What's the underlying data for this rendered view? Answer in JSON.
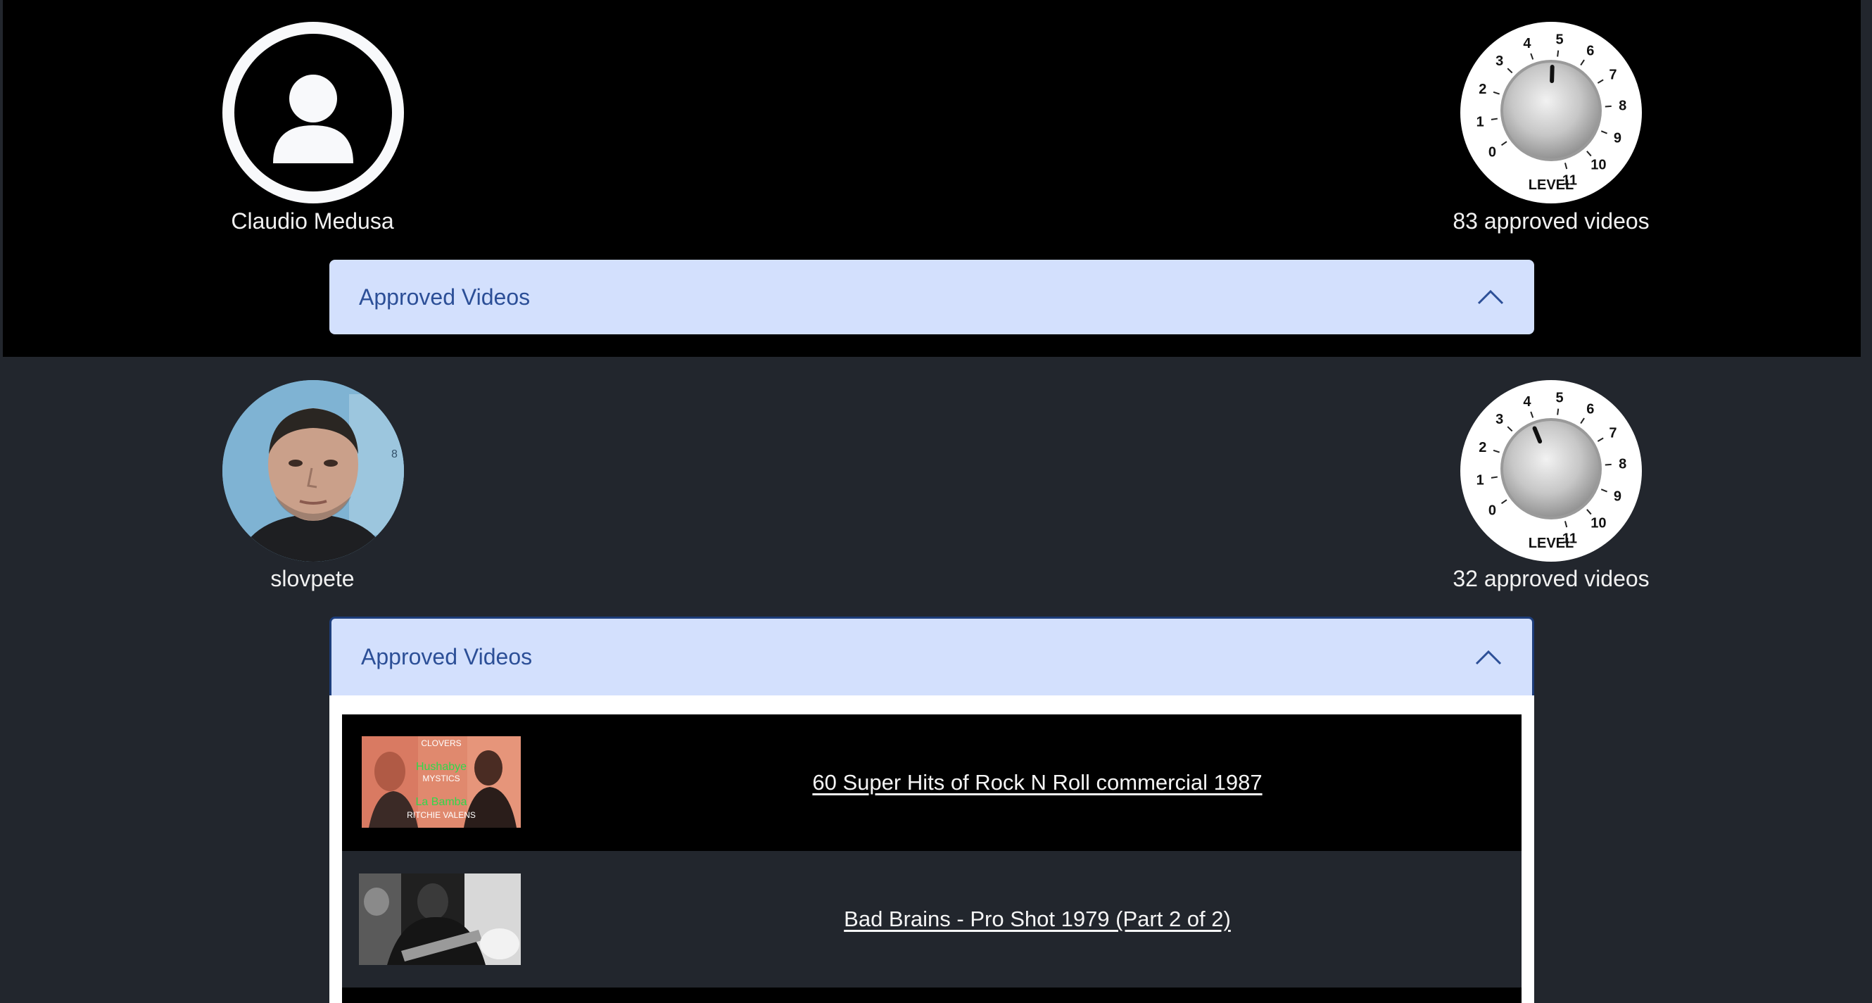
{
  "users": [
    {
      "name": "Claudio Medusa",
      "avatar_icon": "user-silhouette-icon",
      "approved_count_text": "83 approved videos",
      "knob": {
        "label": "LEVEL",
        "ticks": [
          "0",
          "1",
          "2",
          "3",
          "4",
          "5",
          "6",
          "7",
          "8",
          "9",
          "10",
          "11"
        ],
        "level": 4.8
      },
      "accordion": {
        "label": "Approved Videos",
        "expanded": false,
        "chevron_icon": "chevron-up-icon"
      }
    },
    {
      "name": "slovpete",
      "avatar_icon": "user-photo",
      "approved_count_text": "32 approved videos",
      "knob": {
        "label": "LEVEL",
        "ticks": [
          "0",
          "1",
          "2",
          "3",
          "4",
          "5",
          "6",
          "7",
          "8",
          "9",
          "10",
          "11"
        ],
        "level": 3.9
      },
      "accordion": {
        "label": "Approved Videos",
        "expanded": true,
        "chevron_icon": "chevron-up-icon"
      },
      "videos": [
        {
          "title": "60 Super Hits of Rock N Roll commercial 1987",
          "thumb_text": [
            "CLOVERS",
            "Hushabye",
            "MYSTICS",
            "La Bamba",
            "RITCHIE VALENS"
          ]
        },
        {
          "title": "Bad Brains - Pro Shot 1979 (Part 2 of 2)"
        }
      ]
    }
  ],
  "colors": {
    "page_bg": "#22262d",
    "row_black": "#000000",
    "accordion_bg": "#d3e0fd",
    "accordion_text": "#2c4f97",
    "text_light": "#f1f1f1"
  }
}
